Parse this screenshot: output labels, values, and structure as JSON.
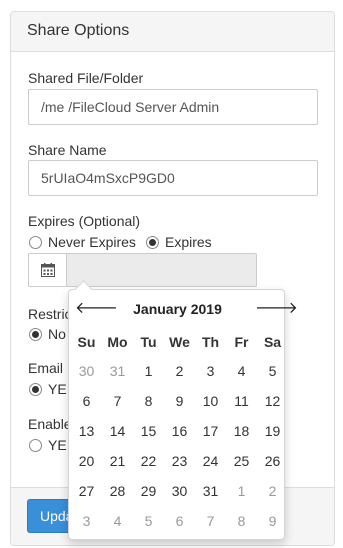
{
  "panel": {
    "title": "Share Options"
  },
  "shared_path": {
    "label": "Shared File/Folder",
    "value": "/me /FileCloud Server Admin"
  },
  "share_name": {
    "label": "Share Name",
    "value": "5rUIaO4mSxcP9GD0"
  },
  "expires": {
    "label": "Expires (Optional)",
    "option_never": "Never Expires",
    "option_expires": "Expires",
    "selected": "Expires",
    "date_value": ""
  },
  "restrict": {
    "label": "Restric",
    "option_no": "No"
  },
  "email": {
    "label": "Email I",
    "option_yes": "YE"
  },
  "enable": {
    "label": "Enable",
    "option_yes": "YE"
  },
  "footer": {
    "update_label": "Upda"
  },
  "datepicker": {
    "month_label": "January 2019",
    "prev": "🡐",
    "next": "🡒",
    "weekdays": [
      "Su",
      "Mo",
      "Tu",
      "We",
      "Th",
      "Fr",
      "Sa"
    ],
    "weeks": [
      [
        {
          "d": "30",
          "m": true
        },
        {
          "d": "31",
          "m": true
        },
        {
          "d": "1"
        },
        {
          "d": "2"
        },
        {
          "d": "3"
        },
        {
          "d": "4"
        },
        {
          "d": "5"
        }
      ],
      [
        {
          "d": "6"
        },
        {
          "d": "7"
        },
        {
          "d": "8"
        },
        {
          "d": "9"
        },
        {
          "d": "10"
        },
        {
          "d": "11"
        },
        {
          "d": "12"
        }
      ],
      [
        {
          "d": "13"
        },
        {
          "d": "14"
        },
        {
          "d": "15"
        },
        {
          "d": "16"
        },
        {
          "d": "17"
        },
        {
          "d": "18"
        },
        {
          "d": "19"
        }
      ],
      [
        {
          "d": "20"
        },
        {
          "d": "21"
        },
        {
          "d": "22"
        },
        {
          "d": "23"
        },
        {
          "d": "24"
        },
        {
          "d": "25"
        },
        {
          "d": "26"
        }
      ],
      [
        {
          "d": "27"
        },
        {
          "d": "28"
        },
        {
          "d": "29"
        },
        {
          "d": "30"
        },
        {
          "d": "31"
        },
        {
          "d": "1",
          "m": true
        },
        {
          "d": "2",
          "m": true
        }
      ],
      [
        {
          "d": "3",
          "m": true
        },
        {
          "d": "4",
          "m": true
        },
        {
          "d": "5",
          "m": true
        },
        {
          "d": "6",
          "m": true
        },
        {
          "d": "7",
          "m": true
        },
        {
          "d": "8",
          "m": true
        },
        {
          "d": "9",
          "m": true
        }
      ]
    ]
  },
  "colors": {
    "primary": "#3a8fd9",
    "panel_header": "#f5f5f5",
    "muted_day": "#999999"
  },
  "icons": {
    "date_addon": "calendar-icon"
  }
}
